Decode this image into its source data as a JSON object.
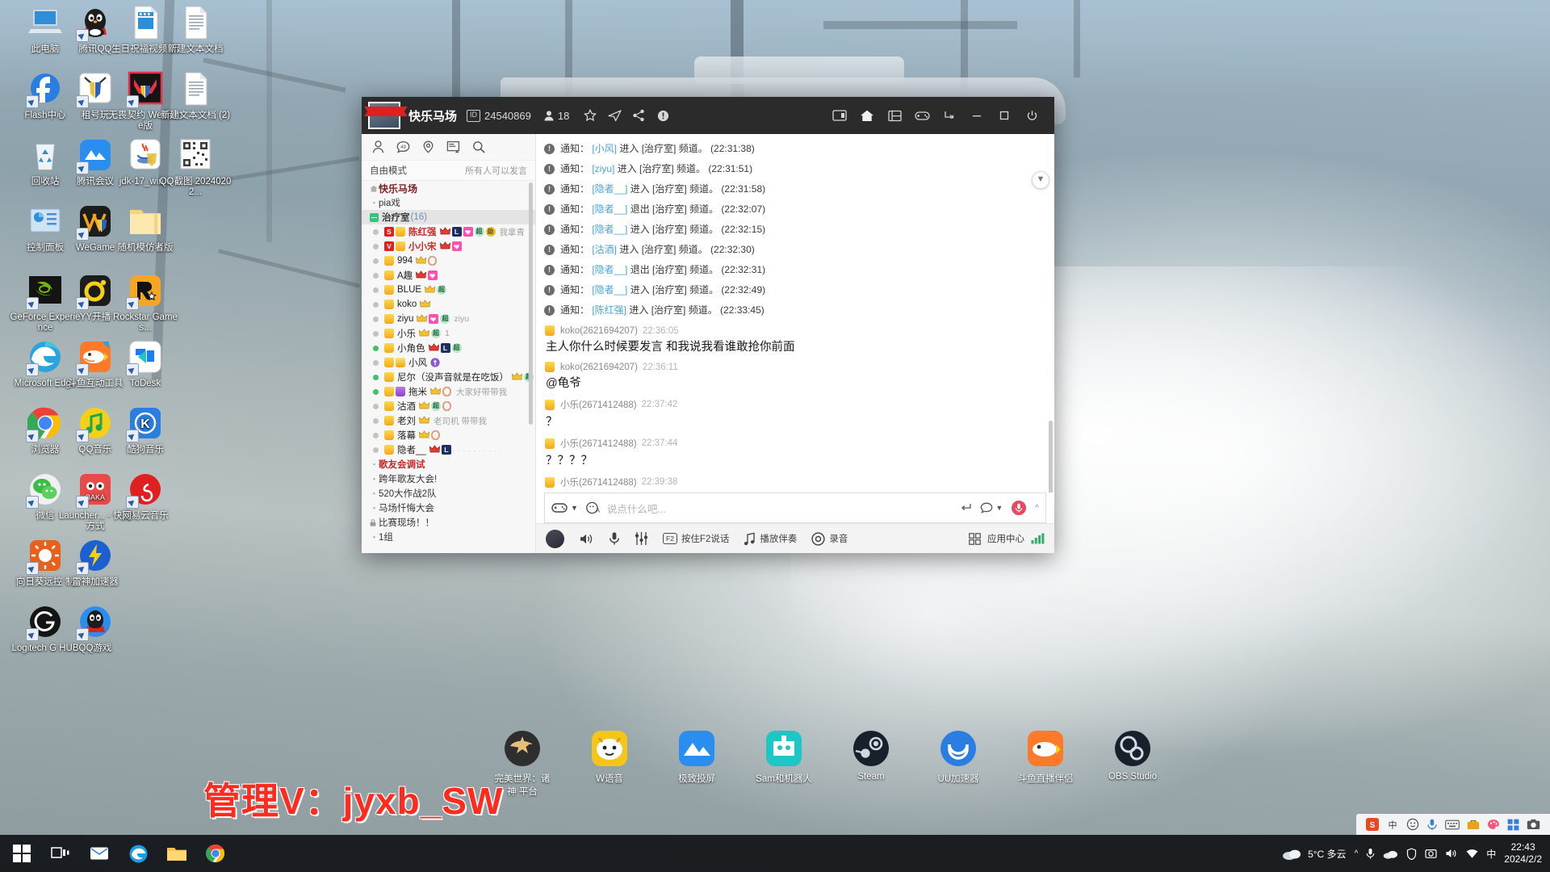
{
  "desktop": {
    "icons": [
      {
        "label": "此电脑",
        "icon": "this-pc-icon",
        "shortcut": false
      },
      {
        "label": "腾讯QQ",
        "icon": "qq-penguin-icon",
        "shortcut": true
      },
      {
        "label": "生日祝福视频 新",
        "icon": "video-file-icon",
        "shortcut": false
      },
      {
        "label": "新建文本文档",
        "icon": "text-file-icon",
        "shortcut": false
      },
      {
        "label": "Flash中心",
        "icon": "flash-icon",
        "shortcut": true
      },
      {
        "label": "租号玩",
        "icon": "zuhaowan-icon",
        "shortcut": true
      },
      {
        "label": "无畏契约 WeGame版",
        "icon": "valorant-wegame-icon",
        "shortcut": true
      },
      {
        "label": "新建文本文档 (2)",
        "icon": "text-file-icon",
        "shortcut": false
      },
      {
        "label": "回收站",
        "icon": "recycle-bin-icon",
        "shortcut": false
      },
      {
        "label": "腾讯会议",
        "icon": "tencent-meeting-icon",
        "shortcut": true
      },
      {
        "label": "jdk-17_win...",
        "icon": "java-installer-icon",
        "shortcut": false
      },
      {
        "label": "QQ截图 20240202...",
        "icon": "qr-screenshot-icon",
        "shortcut": false
      },
      {
        "label": "控制面板",
        "icon": "control-panel-icon",
        "shortcut": false
      },
      {
        "label": "WeGame",
        "icon": "wegame-icon",
        "shortcut": true
      },
      {
        "label": "随机模仿者版",
        "icon": "folder-icon",
        "shortcut": false
      },
      {
        "label": "GeForce Experience",
        "icon": "geforce-icon",
        "shortcut": true
      },
      {
        "label": "YY开播",
        "icon": "yy-live-icon",
        "shortcut": true
      },
      {
        "label": "Rockstar Games...",
        "icon": "rockstar-icon",
        "shortcut": true
      },
      {
        "label": "Microsoft Edge",
        "icon": "edge-icon",
        "shortcut": true
      },
      {
        "label": "斗鱼互动工具",
        "icon": "douyu-tool-icon",
        "shortcut": true
      },
      {
        "label": "ToDesk",
        "icon": "todesk-icon",
        "shortcut": true
      },
      {
        "label": "浏览器",
        "icon": "chrome-icon",
        "shortcut": true
      },
      {
        "label": "QQ音乐",
        "icon": "qq-music-icon",
        "shortcut": true
      },
      {
        "label": "酷狗音乐",
        "icon": "kugou-icon",
        "shortcut": true
      },
      {
        "label": "微信",
        "icon": "wechat-icon",
        "shortcut": true
      },
      {
        "label": "Launcher... - 快捷方式",
        "icon": "baka-launcher-icon",
        "shortcut": true
      },
      {
        "label": "网易云音乐",
        "icon": "netease-music-icon",
        "shortcut": true
      },
      {
        "label": "向日葵远控 制",
        "icon": "sunlogin-icon",
        "shortcut": true
      },
      {
        "label": "雷神加速器",
        "icon": "leishen-icon",
        "shortcut": true
      },
      {
        "label": "Logitech G HUB",
        "icon": "logitech-g-icon",
        "shortcut": true
      },
      {
        "label": "QQ游戏",
        "icon": "qq-game-icon",
        "shortcut": true
      }
    ],
    "dock": [
      {
        "label": "完美世界：诸神 平台",
        "icon": "perfect-world-icon"
      },
      {
        "label": "W语音",
        "icon": "w-voice-icon"
      },
      {
        "label": "极致投屏",
        "icon": "screen-cast-icon"
      },
      {
        "label": "Sam和机器人",
        "icon": "sam-robot-icon"
      },
      {
        "label": "Steam",
        "icon": "steam-icon"
      },
      {
        "label": "UU加速器",
        "icon": "uu-booster-icon"
      },
      {
        "label": "斗鱼直播伴侣",
        "icon": "douyu-companion-icon"
      },
      {
        "label": "OBS Studio",
        "icon": "obs-icon"
      }
    ],
    "caption": "管理V：jyxb_SW"
  },
  "taskbar": {
    "start": "start-icon",
    "buttons": [
      "task-view-icon",
      "mail-icon",
      "edge-icon",
      "file-explorer-icon",
      "chrome-icon"
    ],
    "weather": "5°C 多云",
    "clock_time": "22:43",
    "clock_date": "2024/2/2",
    "tray_ime": "中",
    "tray_icons": [
      "sogou-icon",
      "ime-cn-icon",
      "emoji-icon",
      "mic-icon",
      "keyboard-icon",
      "toolbox-icon",
      "palette-icon",
      "grid-icon",
      "camera-icon"
    ],
    "systray_icons": [
      "weather-icon",
      "chevron-up-icon",
      "mic-icon",
      "cloud-icon",
      "shield-icon",
      "screenshot-icon",
      "volume-icon",
      "network-icon",
      "ime-cn-icon"
    ]
  },
  "yy": {
    "title": {
      "room_name": "快乐马场",
      "id_label": "ID",
      "id_value": "24540869",
      "member_icon": "person-icon",
      "member_count": "18",
      "icons": [
        "star-icon",
        "paper-plane-icon",
        "share-icon",
        "alert-icon"
      ],
      "right_icons": [
        "window-split-icon",
        "home-icon",
        "grid-icon",
        "game-icon",
        "download-icon"
      ],
      "window_controls": [
        "minimize-icon",
        "maximize-icon",
        "power-icon"
      ]
    },
    "left": {
      "tools": [
        "person-icon",
        "chat-bubble-icon",
        "location-icon",
        "template-icon",
        "search-icon"
      ],
      "mode_label": "自由模式",
      "mode_hint": "所有人可以发言",
      "channels": [
        {
          "type": "root",
          "name": "快乐马场",
          "icon": "home-icon"
        },
        {
          "type": "sub",
          "name": "pia戏"
        },
        {
          "type": "group",
          "name": "治疗室",
          "count": "(16)"
        }
      ],
      "members": [
        {
          "online": false,
          "badges": [
            "s",
            "shirt"
          ],
          "name": "陈红强",
          "red": true,
          "after": [
            "crownr",
            "L",
            "heart",
            "chao",
            "xun"
          ],
          "tail": "我拿青"
        },
        {
          "online": false,
          "badges": [
            "v",
            "shirt"
          ],
          "name": "小小宋",
          "red": true,
          "after": [
            "crownr",
            "heart"
          ],
          "tail": ""
        },
        {
          "online": false,
          "badges": [
            "shirt"
          ],
          "name": "994",
          "after": [
            "crown",
            "ring"
          ],
          "tail": ""
        },
        {
          "online": false,
          "badges": [
            "shirt"
          ],
          "name": "A趣",
          "after": [
            "crownr",
            "heart"
          ],
          "tail": ""
        },
        {
          "online": false,
          "badges": [
            "shirt"
          ],
          "name": "BLUE",
          "after": [
            "crown",
            "chao"
          ],
          "tail": ""
        },
        {
          "online": false,
          "badges": [
            "shirt"
          ],
          "name": "koko",
          "after": [
            "crown"
          ],
          "tail": ""
        },
        {
          "online": false,
          "badges": [
            "shirt"
          ],
          "name": "ziyu",
          "after": [
            "crown",
            "heart",
            "chao"
          ],
          "tail": "ziyu"
        },
        {
          "online": false,
          "badges": [
            "shirt"
          ],
          "name": "小乐",
          "after": [
            "crown",
            "chao"
          ],
          "tail": "1"
        },
        {
          "online": true,
          "badges": [
            "shirt"
          ],
          "name": "小角色",
          "after": [
            "crownr",
            "L",
            "chao"
          ],
          "tail": ""
        },
        {
          "online": false,
          "badges": [
            "shirt",
            "gold2"
          ],
          "name": "小风",
          "after": [
            "pur"
          ],
          "tail": ""
        },
        {
          "online": true,
          "badges": [
            "shirt"
          ],
          "name": "尼尔（没声音就是在吃饭）",
          "after": [
            "crown",
            "chao"
          ],
          "tail": ""
        },
        {
          "online": true,
          "badges": [
            "shirt",
            "purple"
          ],
          "name": "拖米",
          "after": [
            "crown",
            "ring"
          ],
          "tail": "大家好带带我"
        },
        {
          "online": false,
          "badges": [
            "shirt"
          ],
          "name": "沽酒",
          "after": [
            "crown",
            "chao",
            "ring"
          ],
          "tail": ""
        },
        {
          "online": false,
          "badges": [
            "shirt"
          ],
          "name": "老刘",
          "after": [
            "crown"
          ],
          "tail": "老司机 带带我"
        },
        {
          "online": false,
          "badges": [
            "shirt"
          ],
          "name": "落幕",
          "after": [
            "crown",
            "ring"
          ],
          "tail": ""
        },
        {
          "online": false,
          "badges": [
            "shirt"
          ],
          "name": "隐者__",
          "after": [
            "crownr",
            "L",
            "dots"
          ],
          "tail": ""
        }
      ],
      "channels_bottom": [
        {
          "type": "red",
          "name": "歌友会调试"
        },
        {
          "type": "sub",
          "name": "跨年歌友大会!"
        },
        {
          "type": "sub",
          "name": "520大作战2队"
        },
        {
          "type": "sub",
          "name": "马场忏悔大会"
        },
        {
          "type": "lock",
          "name": "比赛现场！！"
        },
        {
          "type": "sub",
          "name": "1组"
        }
      ]
    },
    "messages": [
      {
        "kind": "notice",
        "prefix": "通知：",
        "user": "小风",
        "action": "进入",
        "channel": "治疗室",
        "suffix": "频道。",
        "time": "(22:31:38)"
      },
      {
        "kind": "notice",
        "prefix": "通知：",
        "user": "ziyu",
        "action": "进入",
        "channel": "治疗室",
        "suffix": "频道。",
        "time": "(22:31:51)"
      },
      {
        "kind": "notice",
        "prefix": "通知：",
        "user": "隐者__",
        "action": "进入",
        "channel": "治疗室",
        "suffix": "频道。",
        "time": "(22:31:58)"
      },
      {
        "kind": "notice",
        "prefix": "通知：",
        "user": "隐者__",
        "action": "退出",
        "channel": "治疗室",
        "suffix": "频道。",
        "time": "(22:32:07)"
      },
      {
        "kind": "notice",
        "prefix": "通知：",
        "user": "隐者__",
        "action": "进入",
        "channel": "治疗室",
        "suffix": "频道。",
        "time": "(22:32:15)"
      },
      {
        "kind": "notice",
        "prefix": "通知：",
        "user": "沽酒",
        "action": "进入",
        "channel": "治疗室",
        "suffix": "频道。",
        "time": "(22:32:30)"
      },
      {
        "kind": "notice",
        "prefix": "通知：",
        "user": "隐者__",
        "action": "退出",
        "channel": "治疗室",
        "suffix": "频道。",
        "time": "(22:32:31)"
      },
      {
        "kind": "notice",
        "prefix": "通知：",
        "user": "隐者__",
        "action": "进入",
        "channel": "治疗室",
        "suffix": "频道。",
        "time": "(22:32:49)"
      },
      {
        "kind": "notice",
        "prefix": "通知：",
        "user": "陈红强",
        "action": "进入",
        "channel": "治疗室",
        "suffix": "频道。",
        "time": "(22:33:45)"
      },
      {
        "kind": "chat",
        "user": "koko(2621694207)",
        "time": "22:36:05",
        "text": "主人你什么时候要发言 和我说我看谁敢抢你前面"
      },
      {
        "kind": "chat",
        "user": "koko(2621694207)",
        "time": "22:36:11",
        "text": "@龟爷"
      },
      {
        "kind": "chat",
        "user": "小乐(2671412488)",
        "time": "22:37:42",
        "text": "？"
      },
      {
        "kind": "chat",
        "user": "小乐(2671412488)",
        "time": "22:37:44",
        "text": "？？？？"
      },
      {
        "kind": "chat",
        "user": "小乐(2671412488)",
        "time": "22:39:38",
        "text": "？"
      }
    ],
    "input": {
      "placeholder": "说点什么吧...",
      "emoji_icon": "game-face-icon",
      "dropdown_icon": "chevron-down-icon",
      "sticker_icon": "sticker-a-icon",
      "enter_icon": "enter-key-icon",
      "bubble_icon": "chat-bubble-icon",
      "mic_icon": "mic-round-icon",
      "collapse_icon": "chevron-up-icon"
    },
    "bottom": {
      "avatar": "user-avatar",
      "speaker_icon": "speaker-icon",
      "mic_icon": "mic-icon",
      "mixer_icon": "mixer-icon",
      "ptt_key": "F2",
      "ptt_label": "按住F2说话",
      "accompany_icon": "music-note-icon",
      "accompany_label": "播放伴奏",
      "record_icon": "record-circle-icon",
      "record_label": "录音",
      "app_center_icon": "apps-icon",
      "app_center_label": "应用中心",
      "signal_icon": "signal-bars-icon"
    },
    "scroll_down_icon": "arrow-down-icon"
  }
}
